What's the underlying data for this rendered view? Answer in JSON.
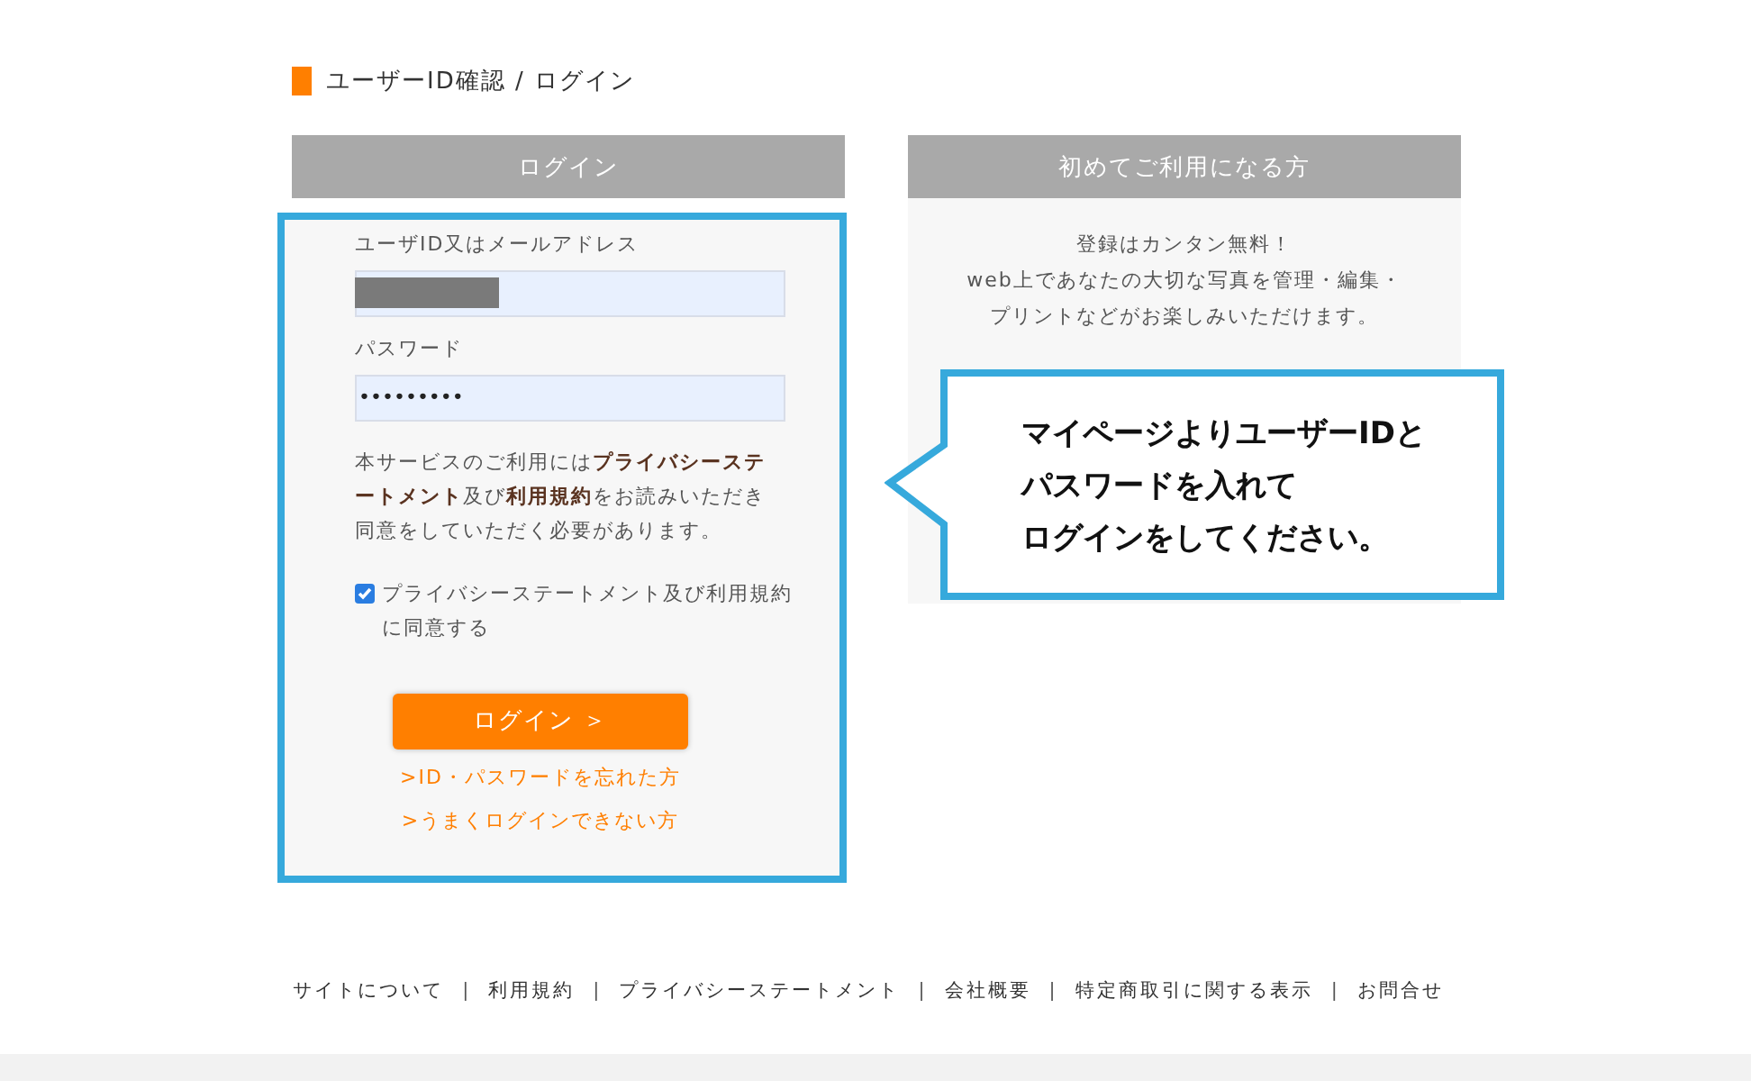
{
  "breadcrumb": {
    "title": "ユーザーID確認 / ログイン"
  },
  "login": {
    "header": "ログイン",
    "user_id": {
      "label": "ユーザID又はメールアドレス"
    },
    "password": {
      "label": "パスワード",
      "value": "•••••••••"
    },
    "notice": "本サービスのご利用には**プライバシーステートメント**及び**利用規約**をお読みいただき同意をしていただく必要があります。",
    "agree": {
      "label": "プライバシーステートメント及び利用規約に同意する",
      "checked": true
    },
    "button": "ログイン ＞",
    "links": [
      ">ID・パスワードを忘れた方",
      ">うまくログインできない方"
    ]
  },
  "guide": {
    "header": "初めてご利用になる方",
    "lines": [
      "登録はカンタン無料！",
      "web上であなたの大切な写真を管理・編集・",
      "プリントなどがお楽しみいただけます。"
    ]
  },
  "callout": {
    "lines": [
      "マイページよりユーザーIDと",
      "パスワードを入れて",
      "ログインをしてください。"
    ]
  },
  "footer": {
    "separator": "|",
    "links": [
      "サイトについて",
      "利用規約",
      "プライバシーステートメント",
      "会社概要",
      "特定商取引に関する表示",
      "お問合せ"
    ]
  }
}
